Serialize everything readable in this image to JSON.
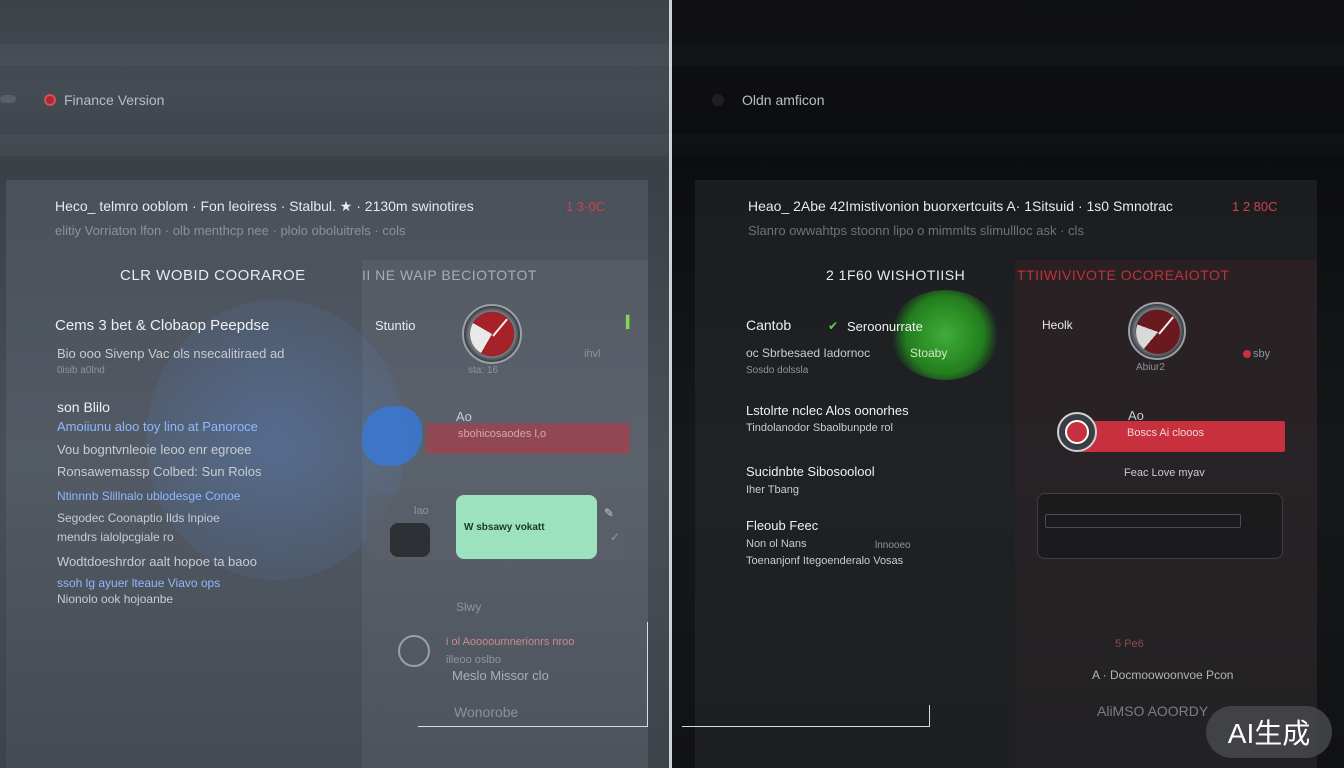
{
  "left": {
    "window_title": "Finance Version",
    "header": {
      "title": "Heco_ telmro ooblom · Fon leoiress · Stalbul. ★ · 2130m swinotires",
      "badge": "1 3·0C",
      "subtitle": "elitiy Vorriaton lfon · olb menthcp nee · plolo oboluitrels · cols"
    },
    "section_titles": {
      "left": "CLR WOBID COORAROE",
      "right": "II NE WAIP BECIOTOTOT"
    },
    "block1": {
      "title": "Cems  3 bet & Clobaop Peepdse",
      "line1": "Bio ooo Sivenp Vac ols nsecalitiraed ad",
      "line2": "0isib a0lnd"
    },
    "block2": {
      "title": "son Blilo",
      "lines": [
        "Amoiiunu aloo  toy lino at Panoroce",
        "Vou bogntvnleoie leoo enr egroee",
        "Ronsawemassp Colbed: Sun Rolos",
        "Ntinnnb Slillnalo ublodesge Conoe",
        "Segodec Coonaptio Ilds lnpioe",
        "mendrs ialolpcgiale ro",
        "Wodtdoeshrdor aalt hopoe ta baoo",
        "ssoh lg ayuer lteaue Viavo ops",
        "Nionolo ook hojoanbe"
      ]
    },
    "status_label": "Stuntio",
    "gauge_label": "sta: 16",
    "side_label": "ihvl",
    "bar_label": "Ao",
    "bar_text": "sbohicosaodes  l,o",
    "toggle_text": "lao",
    "green_button": "W sbsawy vokatt",
    "small_label": "Slwy",
    "bottom_lines": [
      "i ol Aooooumnerionrs nroo",
      "illeoo oslbo",
      "Meslo Missor  clo"
    ],
    "bottom_button": "Wonorobe"
  },
  "right": {
    "window_title": "Oldn amficon",
    "header": {
      "title": "Heao_ 2Abe 42Imistivonion  buorxertcuits  A· 1Sitsuid · 1s0 Smnotrac",
      "badge": "1 2 80C",
      "subtitle": "Slanro  owwahtps  stoonn lipo  o mimmlts  slimullloc ask · cls"
    },
    "section_titles": {
      "left": "2 1F60 WISHOTIISH",
      "right": "TTIIWIVIVOTE OCOREAIOTOT"
    },
    "block1": {
      "title": "Cantob",
      "title2": "Seroonurrate",
      "line1": "oc Sbrbesaed Iadornoc",
      "line1b": "Stoaby",
      "line2": "Sosdo dolssla"
    },
    "block2": {
      "title": "Lstolrte nclec  Alos oonorhes",
      "line1": "Tindolanodor Sbaolbunpde rol"
    },
    "block3": {
      "title": "Sucidnbte Sibosoolool",
      "line1": "Iher Tbang"
    },
    "block4": {
      "title": "Fleoub Feec",
      "line1": "Non ol Nans",
      "line1b": "lnnooeo",
      "line2": "Toenanjonf Itegoenderalo Vosas"
    },
    "status_label": "Heolk",
    "gauge_label": "Abiur2",
    "side_label": "sby",
    "bar_top_label": "Ao",
    "bar_text": "Boscs       Ai clooos",
    "field_label": "Feac Love myav",
    "bottom_line1": "5 Pe6",
    "bottom_line2": "A · Docmoowoonvoe  Pcon",
    "bottom_button": "AliMSO  AOORDY"
  },
  "watermark": "AI生成",
  "colors": {
    "accent_red": "#c8303e",
    "green_button": "#9ce2bf",
    "blue_accent": "#3a78d4",
    "green_blob": "#3fae37"
  }
}
